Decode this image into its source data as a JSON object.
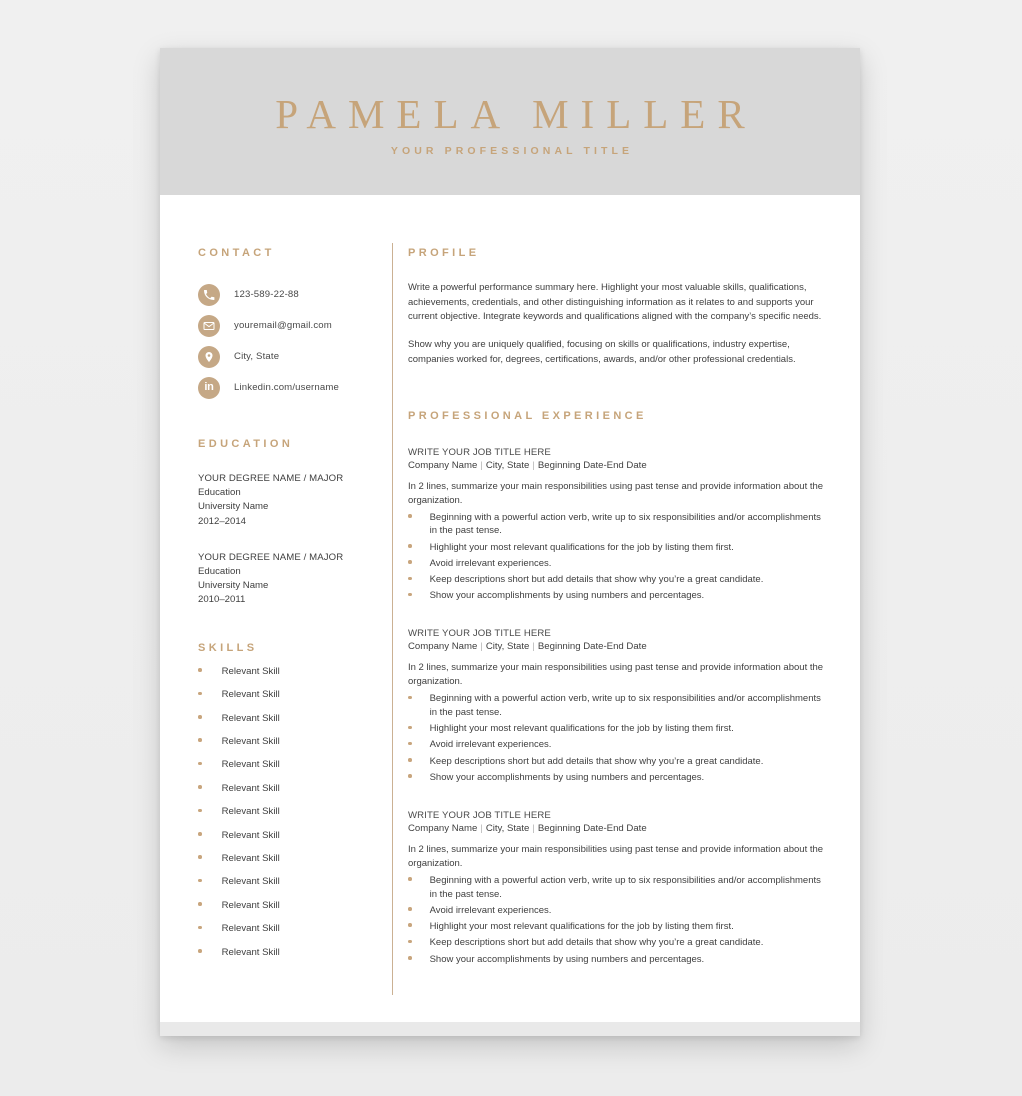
{
  "header": {
    "name": "PAMELA MILLER",
    "subtitle": "YOUR PROFESSIONAL TITLE"
  },
  "colors": {
    "accent": "#c6a47a",
    "icon_circle": "#c5a886",
    "header_band": "#d8d8d8",
    "footer_band": "#e9e9e9",
    "page_background": "#eeeeee",
    "body_text": "#3f3f3f",
    "divider": "#cbb193"
  },
  "contact": {
    "title": "CONTACT",
    "items": [
      {
        "icon": "phone-icon",
        "value": "123-589-22-88"
      },
      {
        "icon": "email-icon",
        "value": "youremail@gmail.com"
      },
      {
        "icon": "location-pin-icon",
        "value": "City, State"
      },
      {
        "icon": "linkedin-icon",
        "value": "Linkedin.com/username"
      }
    ]
  },
  "education": {
    "title": "EDUCATION",
    "entries": [
      {
        "degree": "YOUR DEGREE NAME / MAJOR",
        "level": "Education",
        "school": "University Name",
        "dates": "2012–2014"
      },
      {
        "degree": "YOUR DEGREE NAME / MAJOR",
        "level": "Education",
        "school": "University Name",
        "dates": "2010–2011"
      }
    ]
  },
  "skills": {
    "title": "SKILLS",
    "items": [
      "Relevant Skill",
      "Relevant Skill",
      "Relevant Skill",
      "Relevant Skill",
      "Relevant Skill",
      "Relevant Skill",
      "Relevant Skill",
      "Relevant Skill",
      "Relevant Skill",
      "Relevant Skill",
      "Relevant Skill",
      "Relevant Skill",
      "Relevant Skill"
    ]
  },
  "profile": {
    "title": "PROFILE",
    "paragraphs": [
      "Write a powerful performance summary here. Highlight your most valuable skills, qualifications, achievements, credentials, and other distinguishing information as it relates to and supports your current objective. Integrate keywords and qualifications aligned with the company’s specific needs.",
      "Show why you are uniquely qualified, focusing on skills or qualifications, industry expertise, companies worked for, degrees, certifications, awards, and/or other professional credentials."
    ]
  },
  "experience": {
    "title": "PROFESSIONAL EXPERIENCE",
    "jobs": [
      {
        "title": "WRITE YOUR JOB TITLE HERE",
        "company": "Company Name",
        "location": "City, State",
        "dates": "Beginning Date-End Date",
        "summary": "In 2 lines, summarize your main responsibilities using past tense and provide information about the organization.",
        "bullets": [
          "Beginning with a powerful action verb, write up to six responsibilities and/or accomplishments in the past tense.",
          "Highlight your most relevant qualifications for the job by listing them first.",
          "Avoid irrelevant experiences.",
          "Keep descriptions short but add details that show why you’re a great candidate.",
          "Show your accomplishments by using numbers and percentages."
        ]
      },
      {
        "title": "WRITE YOUR JOB TITLE HERE",
        "company": "Company Name",
        "location": "City, State",
        "dates": "Beginning Date-End Date",
        "summary": "In 2 lines, summarize your main responsibilities using past tense and provide information about the organization.",
        "bullets": [
          "Beginning with a powerful action verb, write up to six responsibilities and/or accomplishments in the past tense.",
          "Highlight your most relevant qualifications for the job by listing them first.",
          "Avoid irrelevant experiences.",
          "Keep descriptions short but add details that show why you’re a great candidate.",
          "Show your accomplishments by using numbers and percentages."
        ]
      },
      {
        "title": "WRITE YOUR JOB TITLE HERE",
        "company": "Company Name",
        "location": "City, State",
        "dates": "Beginning Date-End Date",
        "summary": "In 2 lines, summarize your main responsibilities using past tense and provide information about the organization.",
        "bullets": [
          "Beginning with a powerful action verb, write up to six responsibilities and/or accomplishments in the past tense.",
          "Avoid irrelevant experiences.",
          "Highlight your most relevant qualifications for the job by listing them first.",
          "Keep descriptions short but add details that show why you’re a great candidate.",
          "Show your accomplishments by using numbers and percentages."
        ]
      }
    ]
  },
  "separators": {
    "pipe": "|"
  }
}
